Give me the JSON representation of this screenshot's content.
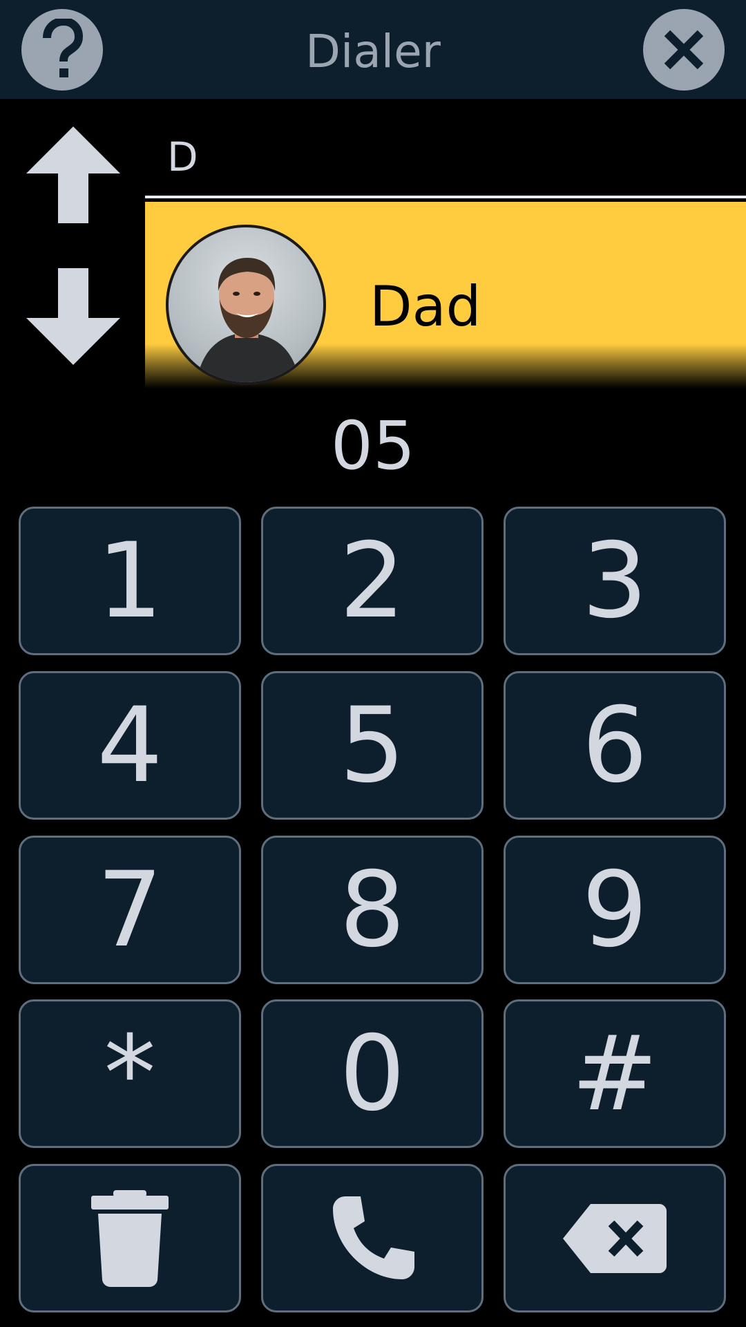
{
  "header": {
    "title": "Dialer",
    "help_icon": "question-mark-icon",
    "close_icon": "close-icon"
  },
  "search": {
    "query": "D"
  },
  "contacts": [
    {
      "name": "Dad",
      "avatar": "person-photo"
    }
  ],
  "dial_number": "05",
  "keypad": {
    "keys": [
      "1",
      "2",
      "3",
      "4",
      "5",
      "6",
      "7",
      "8",
      "9",
      "*",
      "0",
      "#"
    ],
    "actions": {
      "delete_icon": "trash-icon",
      "call_icon": "phone-icon",
      "backspace_icon": "backspace-icon"
    }
  },
  "colors": {
    "header_bg": "#0d1f2d",
    "key_bg": "#0d1f2d",
    "key_border": "#5f6e7c",
    "highlight": "#ffcc40",
    "text": "#d3d8e0",
    "icon_gray": "#9aa5b1"
  }
}
